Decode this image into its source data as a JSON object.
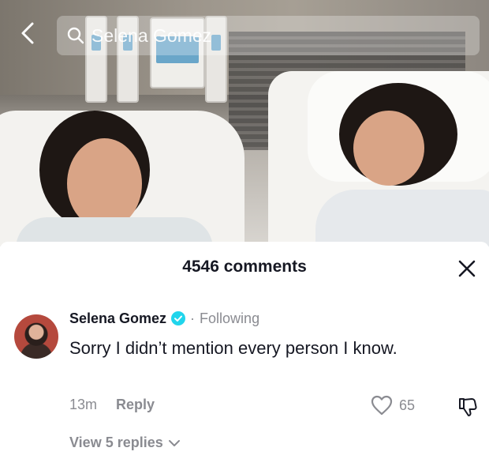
{
  "search": {
    "query": "Selena Gomez"
  },
  "comments_sheet": {
    "count_label": "4546 comments"
  },
  "comment": {
    "author": "Selena Gomez",
    "separator": "·",
    "follow_status": "Following",
    "text": "Sorry I didn’t mention every person I know.",
    "time": "13m",
    "reply_label": "Reply",
    "like_count": "65",
    "view_replies_label": "View 5 replies"
  },
  "colors": {
    "primary_text": "#161823",
    "secondary_text": "#8a8b91",
    "verified": "#20d5ec"
  },
  "icons": {
    "back": "chevron-left-icon",
    "search": "search-icon",
    "close": "close-icon",
    "verified": "verified-badge-icon",
    "like": "heart-outline-icon",
    "dislike": "thumbs-down-icon",
    "expand": "chevron-down-icon"
  }
}
